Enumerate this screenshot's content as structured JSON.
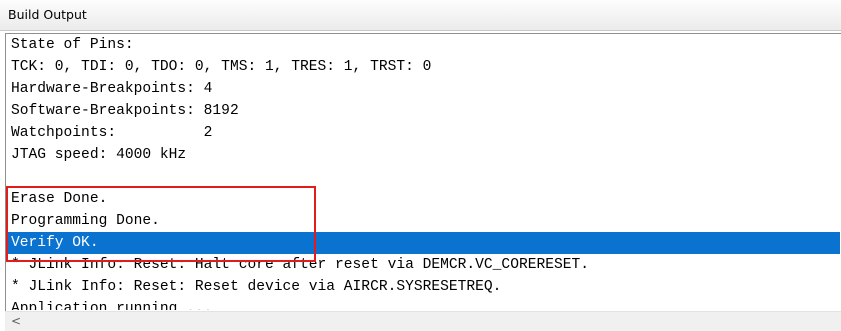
{
  "window": {
    "title": "Build Output"
  },
  "output": {
    "lines": [
      "State of Pins:",
      "TCK: 0, TDI: 0, TDO: 0, TMS: 1, TRES: 1, TRST: 0",
      "Hardware-Breakpoints: 4",
      "Software-Breakpoints: 8192",
      "Watchpoints:          2",
      "JTAG speed: 4000 kHz",
      "",
      "Erase Done.",
      "Programming Done.",
      "Verify OK.",
      "* JLink Info: Reset: Halt core after reset via DEMCR.VC_CORERESET.",
      "* JLink Info: Reset: Reset device via AIRCR.SYSRESETREQ.",
      "Application running ..."
    ],
    "selected_line": "Verify OK."
  },
  "scrollbar": {
    "left_arrow_icon": "chevron-left-icon",
    "left_arrow_glyph": "<"
  },
  "colors": {
    "selection": "#0a73d0",
    "annotation_box": "#e21b1b"
  }
}
